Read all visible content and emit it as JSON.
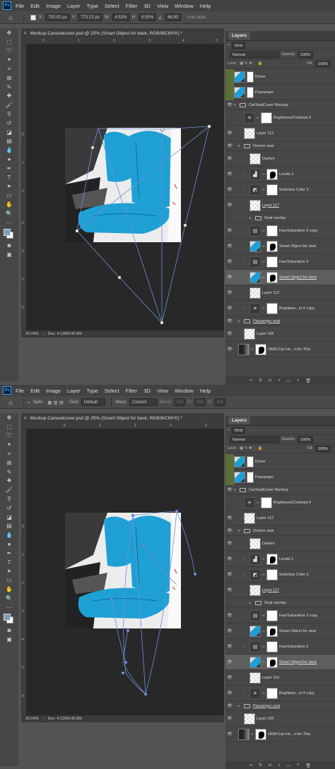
{
  "app": {
    "logo": "Ps",
    "menu": [
      "File",
      "Edit",
      "Image",
      "Layer",
      "Type",
      "Select",
      "Filter",
      "3D",
      "View",
      "Window",
      "Help"
    ]
  },
  "top": {
    "options": {
      "x_label": "X:",
      "x": "792.02 px",
      "y_label": "Y:",
      "y": "773.22 px",
      "w_label": "W:",
      "w": "4.52%",
      "h_label": "H:",
      "h": "6.55%",
      "angle": "46.90",
      "anti_alias": "Anti-alias"
    },
    "doc_title": "Mockup-Carseatcover.psd @ 25% (Smart Object for back, RGB/8/CMYK) *",
    "ruler_top": [
      "0",
      "1",
      "2",
      "3",
      "4",
      "5"
    ],
    "ruler_left": [
      "0",
      "1",
      "2",
      "3",
      "4",
      "5",
      "6"
    ],
    "zoom": "25.04%",
    "doc_info": "Doc: 4.12M/142.8M"
  },
  "bottom": {
    "options": {
      "split": "Split:",
      "grid_label": "Grid:",
      "grid": "Default",
      "warp_label": "Warp:",
      "warp": "Custom",
      "bend_label": "Bend:",
      "bend": "0.0",
      "h_label": "H:",
      "h": "0.0",
      "v_label": "V:",
      "v": "0.0"
    },
    "doc_title": "Mockup-Carseatcover.psd @ 25% (Smart Object for back, RGB/8/CMYK) *",
    "ruler_top": [
      "0",
      "1",
      "2",
      "3",
      "4"
    ],
    "ruler_left": [
      "0",
      "1",
      "2",
      "3",
      "4",
      "5",
      "6"
    ],
    "zoom": "25.04%",
    "doc_info": "Doc: 4.12M/142.8M"
  },
  "layers_panel": {
    "tab": "Layers",
    "kind": "Kind",
    "blend": "Normal",
    "opacity_label": "Opacity:",
    "opacity": "100%",
    "lock_label": "Lock:",
    "fill_label": "Fill:",
    "fill": "100%",
    "layers": [
      {
        "name": "Driver"
      },
      {
        "name": "Passanger"
      },
      {
        "name": "CarSeatCover Mockup"
      },
      {
        "name": "Brightness/Contrast 4"
      },
      {
        "name": "Layer 112"
      },
      {
        "name": "Drivers seat"
      },
      {
        "name": "Darken"
      },
      {
        "name": "Levels 1"
      },
      {
        "name": "Selective Color 2"
      },
      {
        "name": "Layer 117"
      },
      {
        "name": "Seat overlay"
      },
      {
        "name": "Hue/Saturation 3 copy"
      },
      {
        "name": "Smart Object for seat"
      },
      {
        "name": "Hue/Saturation 3"
      },
      {
        "name": "Smart Object for back"
      },
      {
        "name": "Layer 113"
      },
      {
        "name": "Brightnes...st 4 copy"
      },
      {
        "name": "Passanger seat"
      },
      {
        "name": "Layer 105"
      },
      {
        "name": "OEM-Car-He...n-for-This"
      }
    ]
  },
  "colors": {
    "seat": "#1fa0d4",
    "warp_line": "#6f8fd8"
  }
}
